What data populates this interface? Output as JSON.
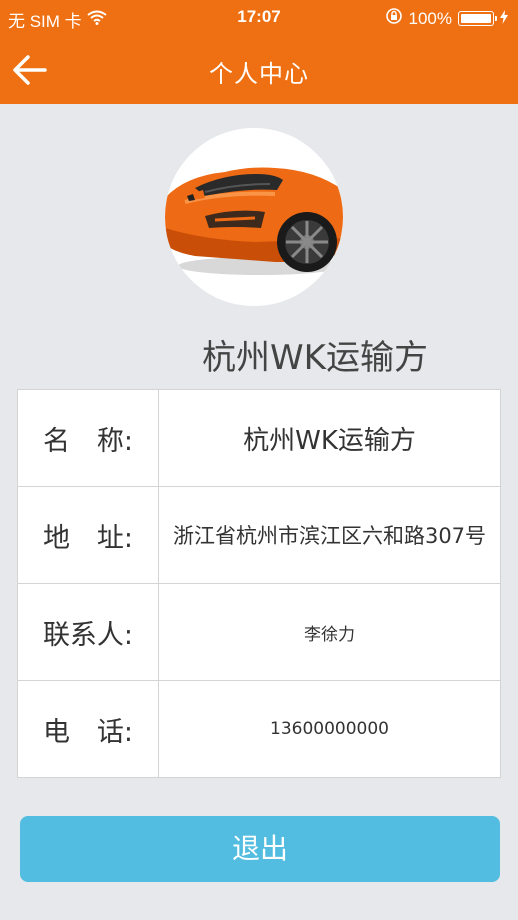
{
  "status_bar": {
    "carrier": "无 SIM 卡",
    "time": "17:07",
    "battery": "100%"
  },
  "navbar": {
    "title": "个人中心",
    "back_icon": "arrow-left-icon"
  },
  "profile": {
    "company_name": "杭州WK运输方",
    "avatar": "orange-sports-car"
  },
  "info": {
    "name_label": "名　称:",
    "name_value": "杭州WK运输方",
    "address_label": "地　址:",
    "address_value": "浙江省杭州市滨江区六和路307号",
    "contact_label": "联系人:",
    "contact_value": "李徐力",
    "phone_label": "电　话:",
    "phone_value": "13600000000"
  },
  "actions": {
    "logout_label": "退出"
  },
  "colors": {
    "brand_orange": "#ef7012",
    "button_blue": "#52bde0",
    "background": "#e6e8eb"
  }
}
